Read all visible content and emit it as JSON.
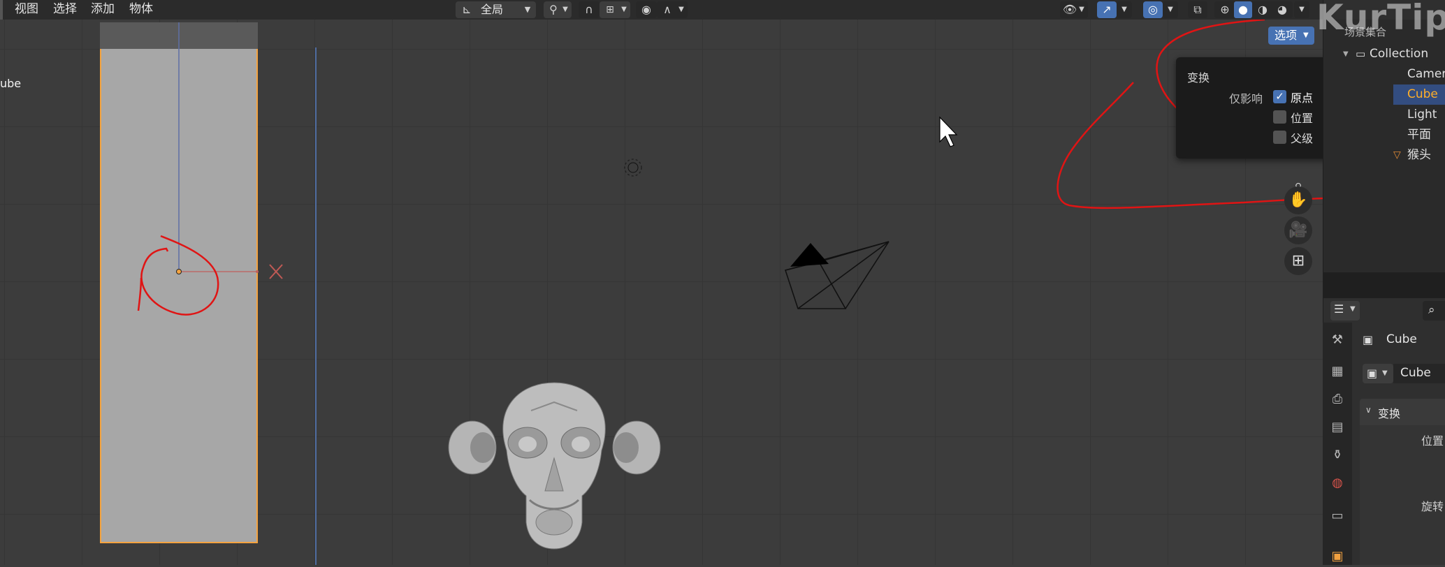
{
  "header": {
    "menu": [
      "视图",
      "选择",
      "添加",
      "物体"
    ],
    "orientation": "全局",
    "options_button": "选项"
  },
  "viewport": {
    "object_label": "ube",
    "x_axis_label": "X"
  },
  "watermark": "KurTips",
  "dropdown": {
    "section_title": "变换",
    "affect_only_label": "仅影响",
    "options": [
      {
        "label": "原点",
        "checked": true
      },
      {
        "label": "位置",
        "checked": false
      },
      {
        "label": "父级",
        "checked": false
      }
    ]
  },
  "outliner": {
    "scene_collection": "场景集合",
    "collection": "Collection",
    "items": [
      {
        "label": "Camer",
        "selected": false
      },
      {
        "label": "Cube",
        "selected": true
      },
      {
        "label": "Light",
        "selected": false
      },
      {
        "label": "平面",
        "selected": false
      },
      {
        "label": "猴头",
        "selected": false
      }
    ]
  },
  "properties": {
    "object_name": "Cube",
    "object_field": "Cube",
    "section_transform": "变换",
    "location_label": "位置",
    "rotation_label": "旋转"
  },
  "colors": {
    "accent": "#4772b3",
    "selected_text": "#ffaf29",
    "selection_outline": "#f4a340",
    "annotation": "#e01414"
  }
}
